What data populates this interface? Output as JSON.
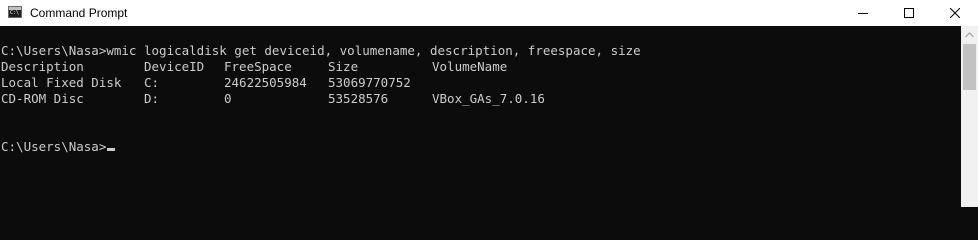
{
  "window": {
    "title": "Command Prompt",
    "icon": "cmd-app-icon",
    "icon_text": "C:\\"
  },
  "controls": {
    "minimize_icon": "minimize-icon",
    "maximize_icon": "maximize-icon",
    "close_icon": "close-icon"
  },
  "console": {
    "command_line": "C:\\Users\\Nasa>wmic logicaldisk get deviceid, volumename, description, freespace, size",
    "headers": [
      "Description",
      "DeviceID",
      "FreeSpace",
      "Size",
      "VolumeName"
    ],
    "rows": [
      [
        "Local Fixed Disk",
        "C:",
        "24622505984",
        "53069770752",
        ""
      ],
      [
        "CD-ROM Disc",
        "D:",
        "0",
        "53528576",
        "VBox_GAs_7.0.16"
      ]
    ],
    "prompt": "C:\\Users\\Nasa>",
    "colors": {
      "background": "#0c0c0c",
      "foreground": "#cccccc"
    }
  },
  "scrollbar": {
    "up_arrow_icon": "scroll-up-arrow-icon"
  }
}
